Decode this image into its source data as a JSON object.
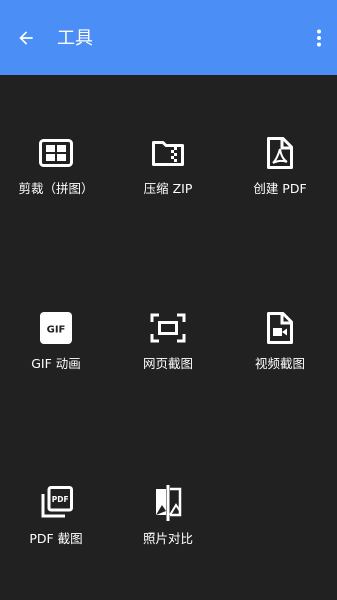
{
  "appbar": {
    "title": "工具",
    "back_icon": "arrow-back-icon",
    "more_icon": "more-vert-icon",
    "color": "#4b8ef5"
  },
  "tools": [
    {
      "label": "剪裁（拼图）",
      "icon": "collage-grid-icon"
    },
    {
      "label": "压缩 ZIP",
      "icon": "zip-folder-icon"
    },
    {
      "label": "创建 PDF",
      "icon": "pdf-file-icon"
    },
    {
      "label": "GIF 动画",
      "icon": "gif-icon"
    },
    {
      "label": "网页截图",
      "icon": "webpage-capture-icon"
    },
    {
      "label": "视频截图",
      "icon": "video-file-icon"
    },
    {
      "label": "PDF 截图",
      "icon": "pdf-layers-icon"
    },
    {
      "label": "照片对比",
      "icon": "compare-icon"
    }
  ],
  "background": "#212121"
}
